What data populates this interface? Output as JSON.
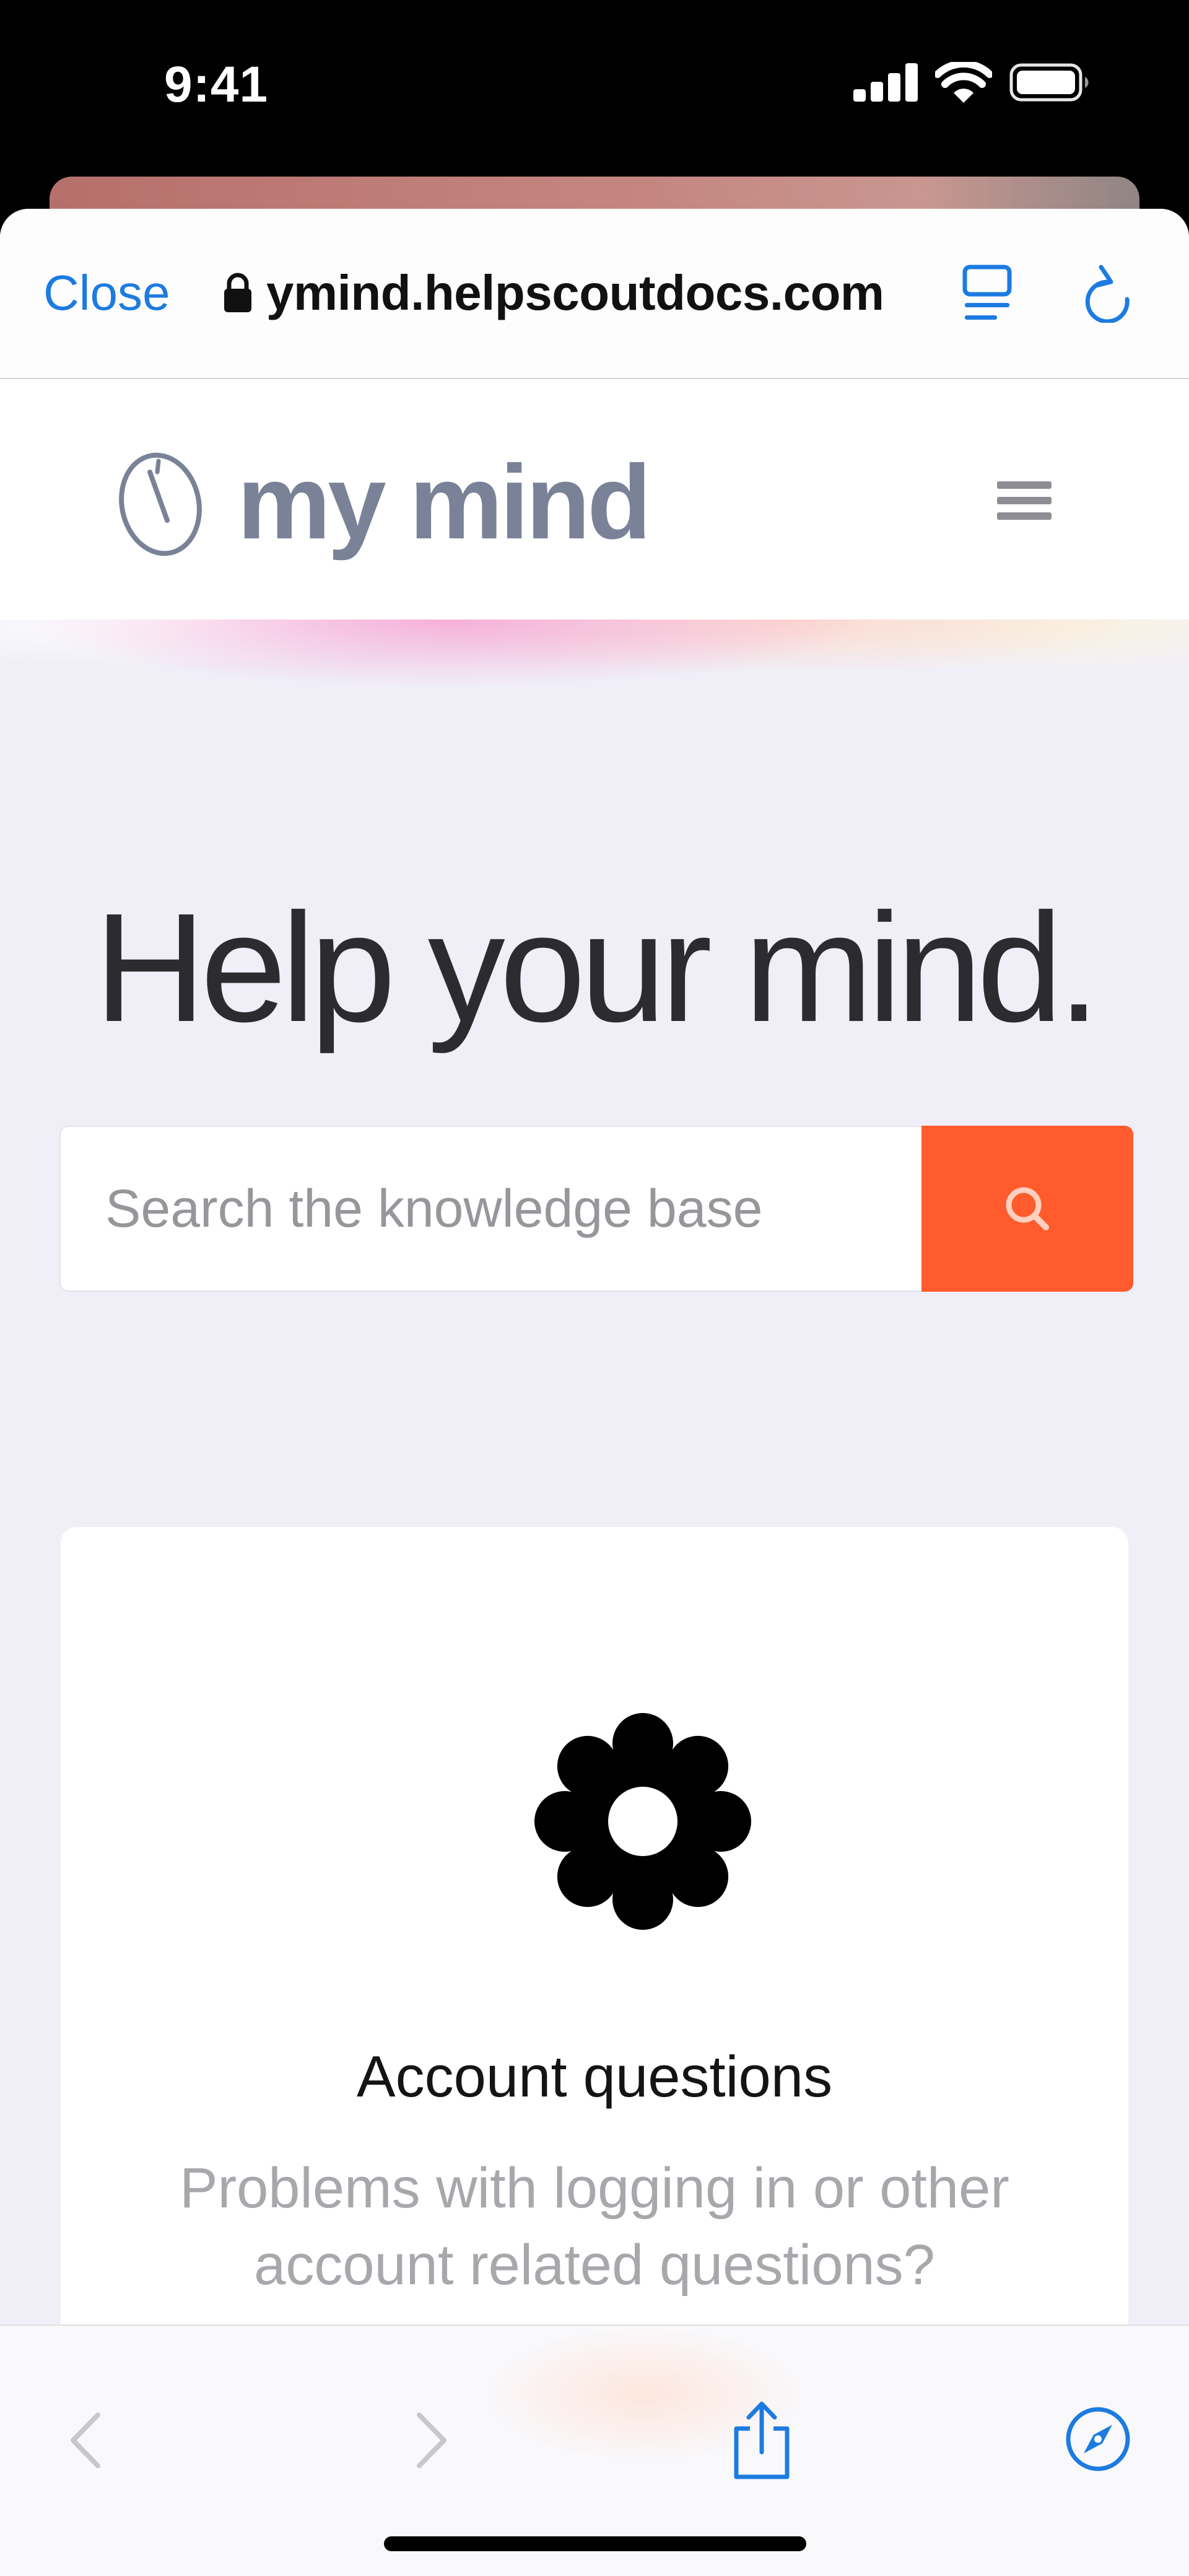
{
  "status_bar": {
    "time": "9:41",
    "icons": [
      "signal-icon",
      "wifi-icon",
      "battery-icon"
    ]
  },
  "browser": {
    "close_label": "Close",
    "url": "ymind.helpscoutdocs.com",
    "icons": [
      "lock-icon",
      "reader-icon",
      "reload-icon"
    ]
  },
  "header": {
    "logo_text": "my mind",
    "menu_icon": "hamburger-icon"
  },
  "hero": {
    "title": "Help your mind."
  },
  "search": {
    "placeholder": "Search the knowledge base",
    "button_icon": "search-icon"
  },
  "card": {
    "icon": "gear-icon",
    "title": "Account questions",
    "description": "Problems with logging in or other account related questions?"
  },
  "toolbar": {
    "icons": [
      "back-icon",
      "forward-icon",
      "share-icon",
      "compass-icon"
    ]
  },
  "colors": {
    "link_blue": "#1c7be0",
    "accent_orange": "#ff5b2c",
    "page_bg": "#f0eff8",
    "logo_gray": "#7a8298"
  }
}
